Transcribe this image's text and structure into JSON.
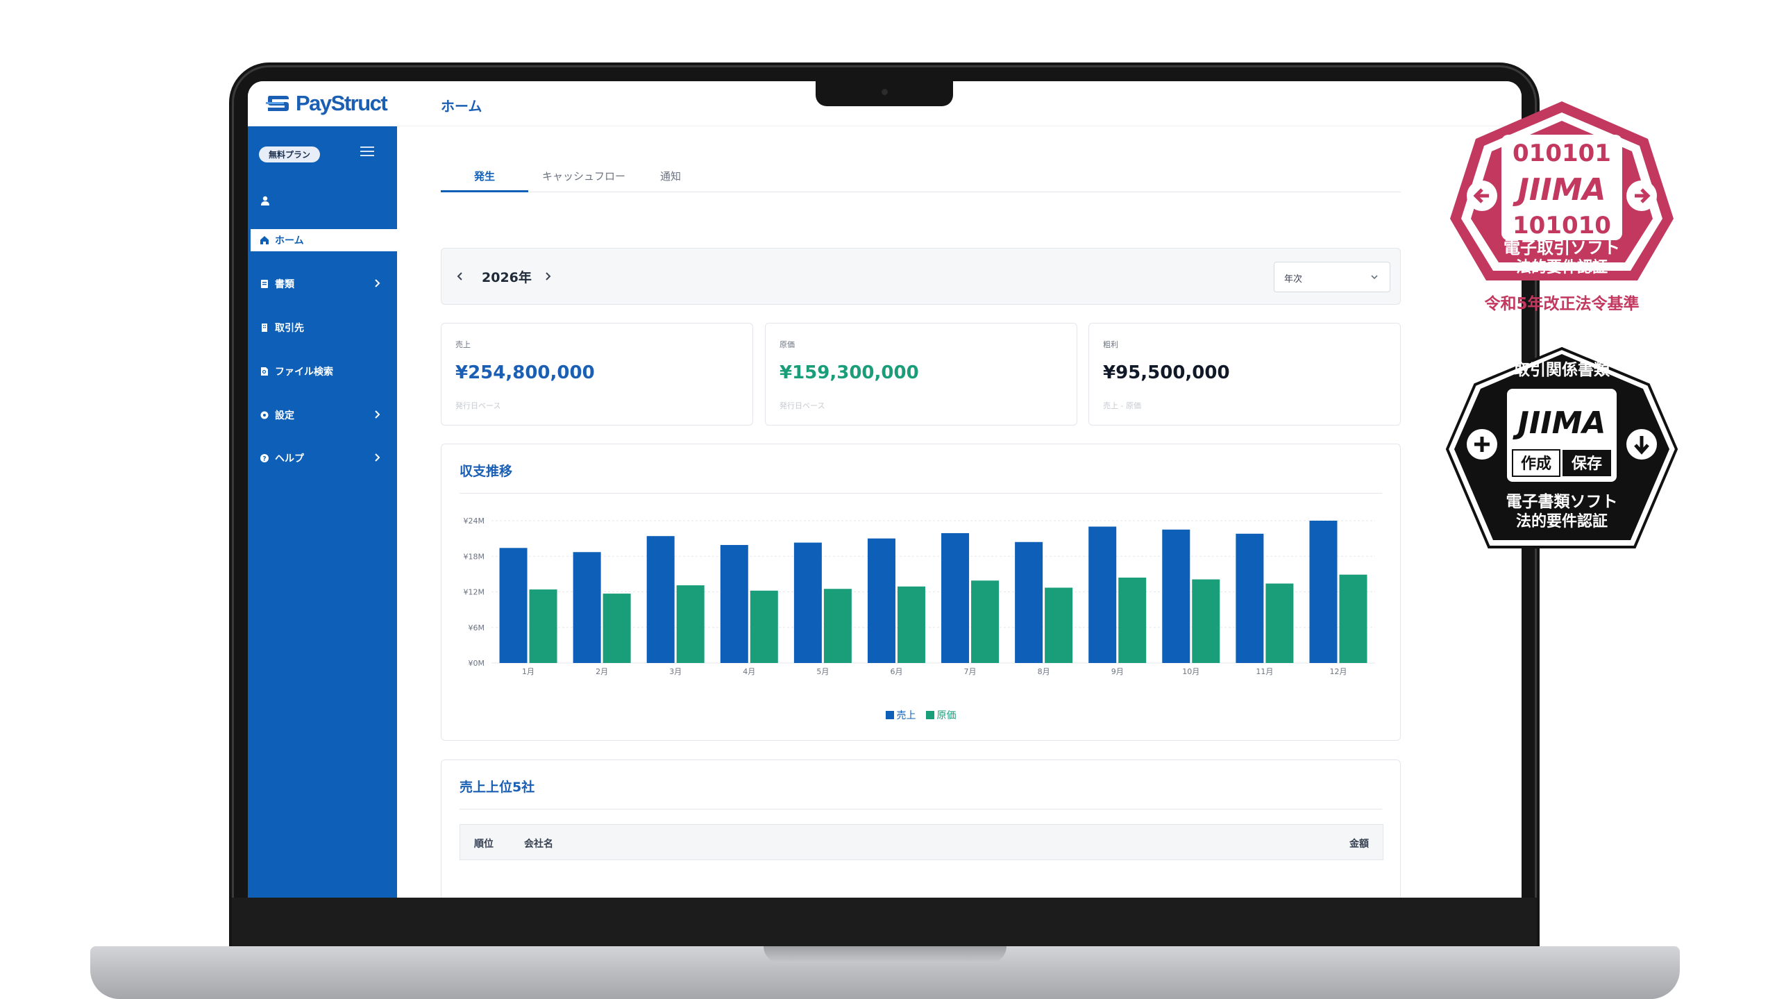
{
  "app": {
    "logo_text": "PayStruct",
    "page_title": "ホーム"
  },
  "sidebar": {
    "plan_badge": "無料プラン",
    "items": [
      {
        "label": "ホーム",
        "icon": "home-icon",
        "active": true
      },
      {
        "label": "書類",
        "icon": "document-icon",
        "chevron": true
      },
      {
        "label": "取引先",
        "icon": "building-icon",
        "chevron": false
      },
      {
        "label": "ファイル検索",
        "icon": "file-search-icon",
        "chevron": false
      },
      {
        "label": "設定",
        "icon": "gear-icon",
        "chevron": true
      },
      {
        "label": "ヘルプ",
        "icon": "help-icon",
        "chevron": true
      }
    ]
  },
  "tabs": [
    {
      "label": "発生",
      "active": true
    },
    {
      "label": "キャッシュフロー",
      "active": false
    },
    {
      "label": "通知",
      "active": false
    }
  ],
  "period": {
    "year_label": "2026年",
    "select_value": "年次"
  },
  "kpis": [
    {
      "label": "売上",
      "value": "¥254,800,000",
      "sub": "発行日ベース",
      "color": "#1a5fb4"
    },
    {
      "label": "原価",
      "value": "¥159,300,000",
      "sub": "発行日ベース",
      "color": "#1a9e7a"
    },
    {
      "label": "粗利",
      "value": "¥95,500,000",
      "sub": "売上 - 原価",
      "color": "#111827"
    }
  ],
  "chart_panel": {
    "title": "収支推移"
  },
  "chart_data": {
    "type": "bar",
    "title": "収支推移",
    "categories": [
      "1月",
      "2月",
      "3月",
      "4月",
      "5月",
      "6月",
      "7月",
      "8月",
      "9月",
      "10月",
      "11月",
      "12月"
    ],
    "series": [
      {
        "name": "売上",
        "color": "#0d5fb8",
        "values": [
          19.4,
          18.7,
          21.4,
          19.9,
          20.3,
          21.0,
          21.9,
          20.4,
          23.0,
          22.5,
          21.8,
          24.0
        ]
      },
      {
        "name": "原価",
        "color": "#1a9e7a",
        "values": [
          12.4,
          11.7,
          13.1,
          12.2,
          12.5,
          12.9,
          13.9,
          12.7,
          14.4,
          14.1,
          13.4,
          14.9
        ]
      }
    ],
    "y_ticks": [
      "¥0M",
      "¥6M",
      "¥12M",
      "¥18M",
      "¥24M"
    ],
    "ylim": [
      0,
      24
    ],
    "grid": true,
    "legend": "bottom-center"
  },
  "top_clients": {
    "title": "売上上位5社",
    "columns": [
      "順位",
      "会社名",
      "金額"
    ]
  },
  "badges": {
    "jiima1": {
      "code_top": "010101",
      "brand": "JIIMA",
      "code_bottom": "101010",
      "line1": "電子取引ソフト",
      "line2": "法的要件認証",
      "caption": "令和5年改正法令基準",
      "color": "#c2385f"
    },
    "jiima2": {
      "header": "取引関係書類",
      "brand": "JIIMA",
      "tag1": "作成",
      "tag2": "保存",
      "line1": "電子書類ソフト",
      "line2": "法的要件認証",
      "color": "#111111"
    }
  }
}
